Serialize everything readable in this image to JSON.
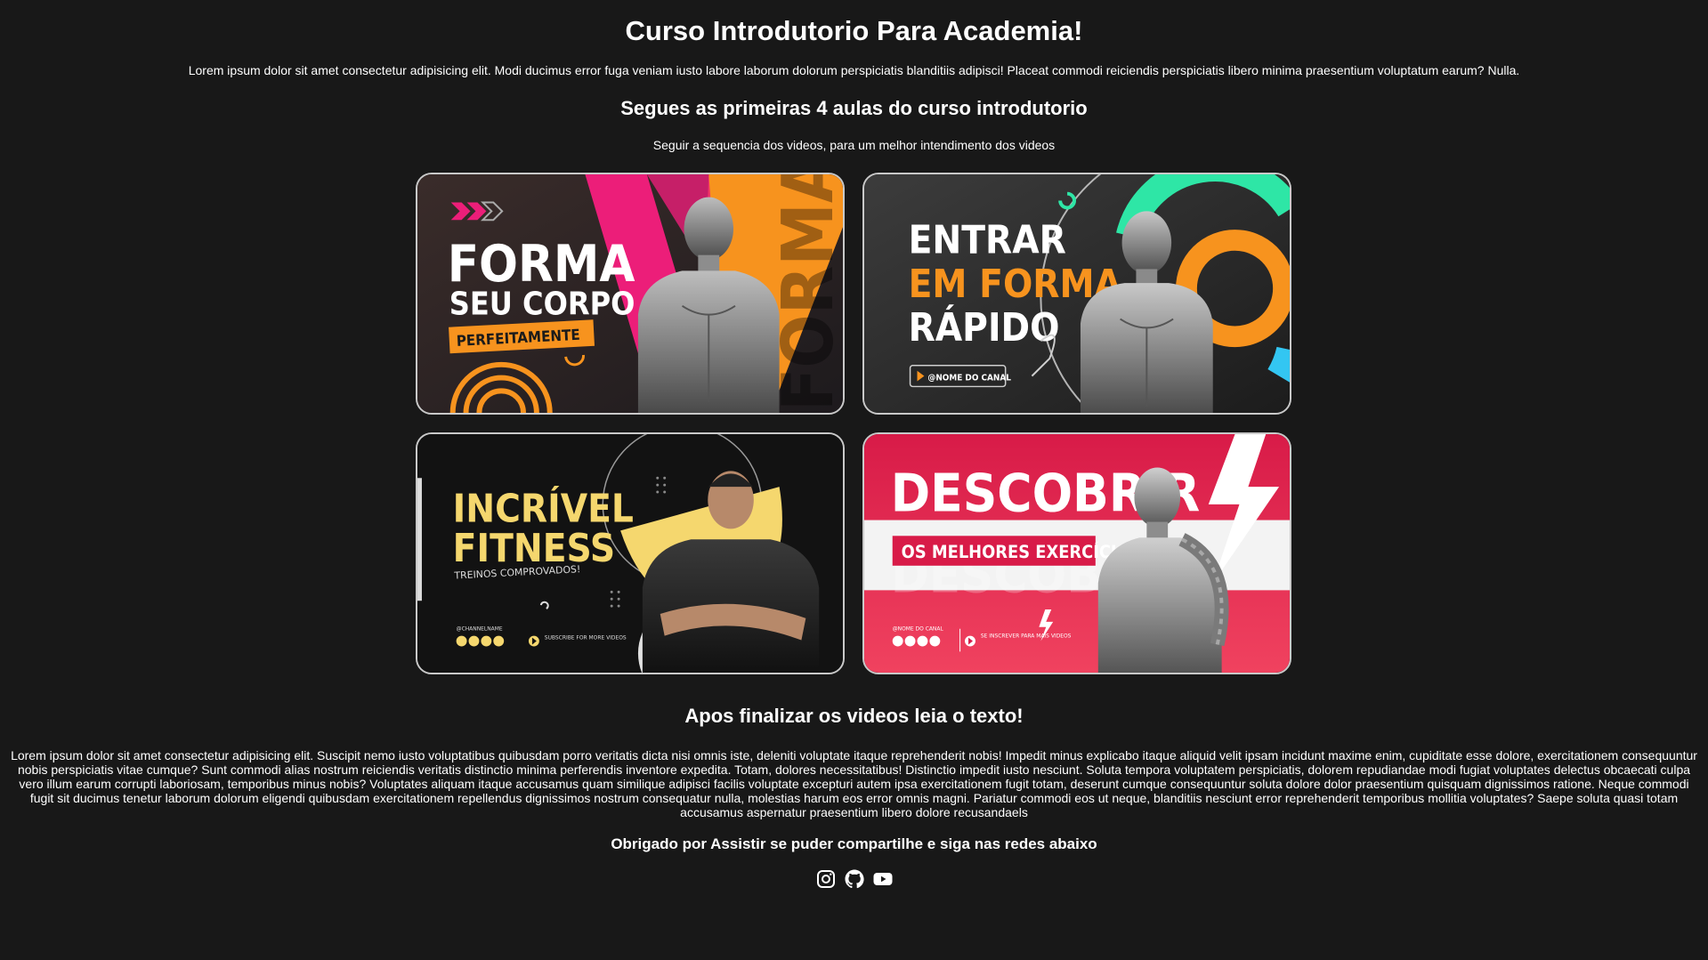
{
  "header": {
    "title": "Curso Introdutorio Para Academia!",
    "intro": "Lorem ipsum dolor sit amet consectetur adipisicing elit. Modi ducimus error fuga veniam iusto labore laborum dolorum perspiciatis blanditiis adipisci! Placeat commodi reiciendis perspiciatis libero minima praesentium voluptatum earum? Nulla."
  },
  "lessons": {
    "heading": "Segues as primeiras 4 aulas do curso introdutorio",
    "subheading": "Seguir a sequencia dos videos, para um melhor intendimento dos videos",
    "videos": [
      {
        "line1": "FORMA",
        "line2": "SEU CORPO",
        "badge": "PERFEITAMENTE",
        "watermark": "FORMA",
        "accent": "#f7931e",
        "accent2": "#ec1e79"
      },
      {
        "line1": "ENTRAR",
        "line2": "EM FORMA",
        "line3": "RÁPIDO",
        "badge": "@NOME DO CANAL",
        "accent": "#f7931e",
        "accent2": "#2ee6a6"
      },
      {
        "line1": "INCRÍVEL",
        "line2": "FITNESS",
        "line3": "TREINOS COMPROVADOS!",
        "channel": "@CHANNELNAME",
        "cta": "SUBSCRIBE FOR MORE VIDEOS",
        "accent": "#f5d76e"
      },
      {
        "line1": "DESCOBRIR",
        "badge": "OS MELHORES EXERCÍCIOS",
        "watermark": "DESCOBRIR",
        "channel": "@NOME DO CANAL",
        "cta": "SE INSCREVER PARA MAIS VIDEOS",
        "accent": "#e31b4b"
      }
    ]
  },
  "after": {
    "heading": "Apos finalizar os videos leia o texto!",
    "body": "Lorem ipsum dolor sit amet consectetur adipisicing elit. Suscipit nemo iusto voluptatibus quibusdam porro veritatis dicta nisi omnis iste, deleniti voluptate itaque reprehenderit nobis! Impedit minus explicabo itaque aliquid velit ipsam incidunt maxime enim, cupiditate esse dolore, exercitationem consequuntur nobis perspiciatis vitae cumque? Sunt commodi alias nostrum reiciendis veritatis distinctio minima perferendis inventore expedita. Totam, dolores necessitatibus! Distinctio impedit iusto nesciunt. Soluta tempora voluptatem perspiciatis, dolorem repudiandae modi fugiat voluptates delectus obcaecati culpa vero illum earum corrupti laboriosam, temporibus minus nobis? Voluptates aliquam itaque accusamus quam similique adipisci facilis voluptate excepturi autem ipsa exercitationem fugit totam, deserunt cumque consequuntur soluta dolore dolor praesentium quisquam dignissimos ratione. Neque commodi fugit sit ducimus tenetur laborum dolorum eligendi quibusdam exercitationem repellendus dignissimos nostrum consequatur nulla, molestias harum eos error omnis magni. Pariatur commodi eos ut neque, blanditiis nesciunt error reprehenderit temporibus mollitia voluptates? Saepe soluta quasi totam accusamus aspernatur praesentium libero dolore recusandaels"
  },
  "footer": {
    "thanks": "Obrigado por Assistir se puder compartilhe e siga nas redes abaixo",
    "social": [
      {
        "icon": "instagram-icon"
      },
      {
        "icon": "github-icon"
      },
      {
        "icon": "youtube-icon"
      }
    ]
  }
}
